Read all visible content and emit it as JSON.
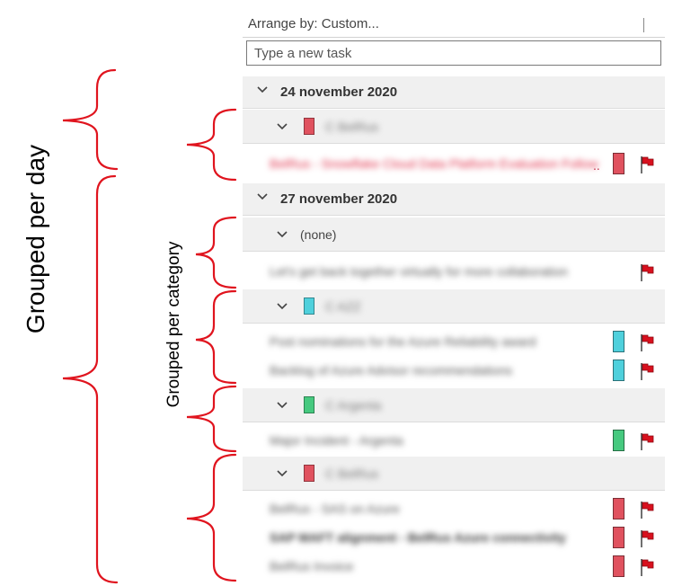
{
  "colors": {
    "bracket": "#e0141e",
    "category_red": "#e0525f",
    "category_teal": "#4fd0dc",
    "category_green": "#46c97f",
    "flag": "#d8101e"
  },
  "annotations": {
    "day_label": "Grouped per day",
    "category_label": "Grouped per category"
  },
  "panel": {
    "arrange_label": "Arrange by: Custom...",
    "new_task_placeholder": "Type a new task"
  },
  "groups": [
    {
      "date": "24 november 2020",
      "categories": [
        {
          "name": "C BelRus",
          "color": "red",
          "tasks": [
            {
              "subject": "BelRus - Snowflake Cloud Data Platform Evaluation Follow",
              "highlight": "red",
              "ellipsis": "..",
              "category_color": "red",
              "flag_icon": "flag-icon"
            }
          ]
        }
      ]
    },
    {
      "date": "27 november 2020",
      "categories": [
        {
          "name": "(none)",
          "color": "none",
          "tasks": [
            {
              "subject": "Let's get back together virtually for more collaboration",
              "category_color": "none",
              "flag_icon": "flag-icon"
            }
          ]
        },
        {
          "name": "C AZZ",
          "color": "teal",
          "tasks": [
            {
              "subject": "Post nominations for the Azure Reliability award",
              "category_color": "teal",
              "flag_icon": "flag-icon"
            },
            {
              "subject": "Backlog of Azure Advisor recommendations",
              "category_color": "teal",
              "flag_icon": "flag-icon"
            }
          ]
        },
        {
          "name": "C Argenta",
          "color": "green",
          "tasks": [
            {
              "subject": "Major Incident - Argenta",
              "category_color": "green",
              "flag_icon": "flag-icon"
            }
          ]
        },
        {
          "name": "C BelRus",
          "color": "red",
          "tasks": [
            {
              "subject": "BelRus - SAS on Azure",
              "category_color": "red",
              "flag_icon": "flag-icon"
            },
            {
              "subject": "SAP MAFT alignment - BelRus Azure connectivity",
              "bold": true,
              "category_color": "red",
              "flag_icon": "flag-icon"
            },
            {
              "subject": "BelRus Invoice",
              "category_color": "red",
              "flag_icon": "flag-icon"
            }
          ]
        }
      ]
    }
  ]
}
